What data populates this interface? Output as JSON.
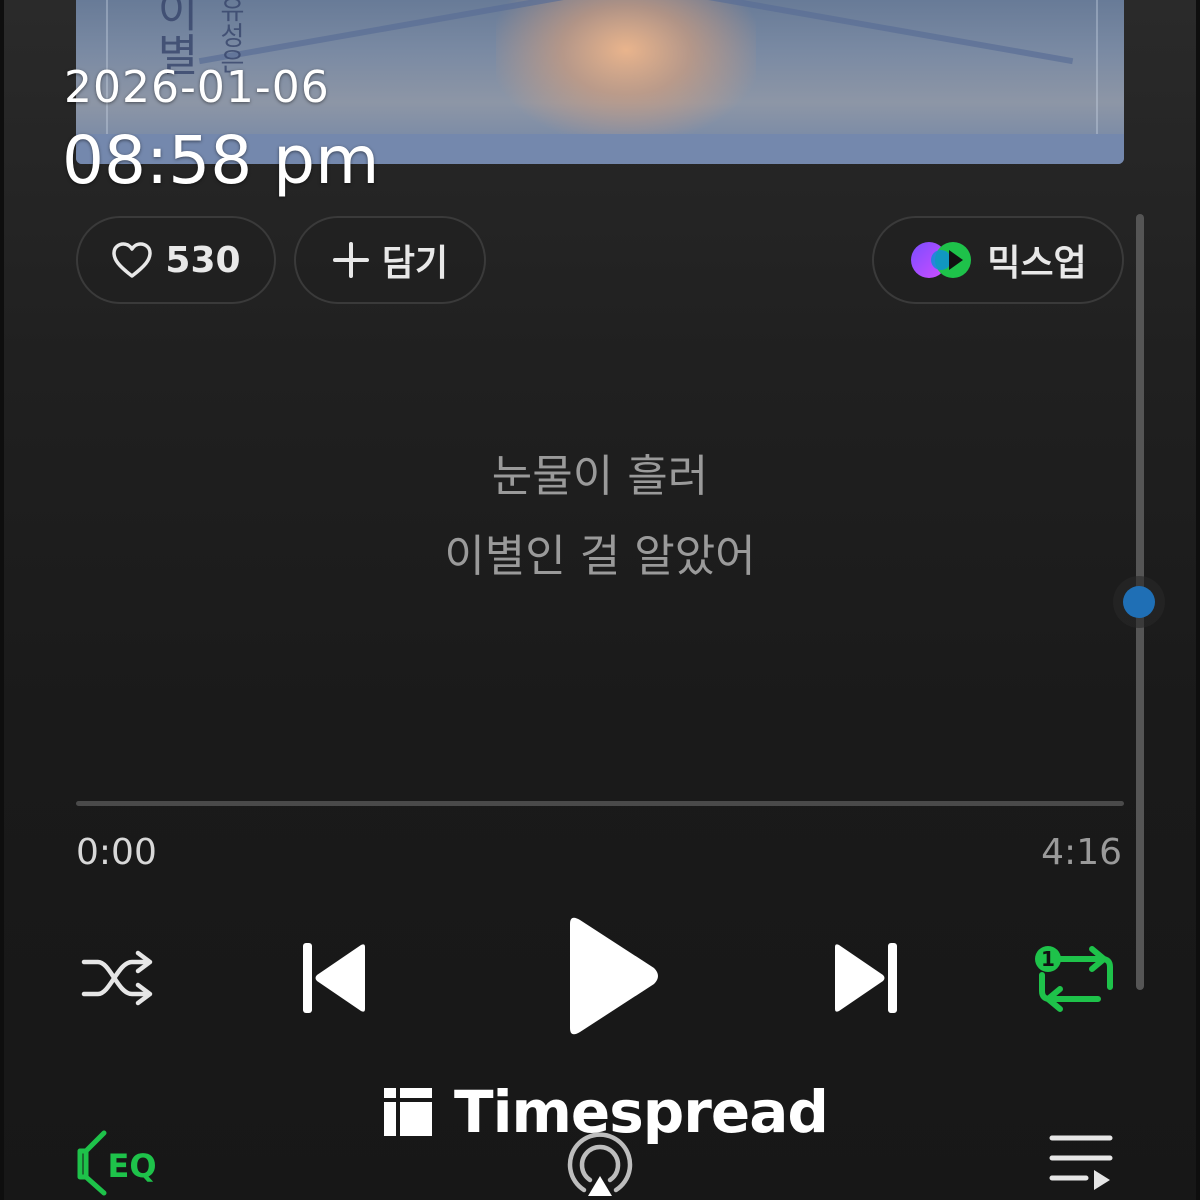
{
  "album_art": {
    "title_vertical": "이별",
    "artist_vertical": "유성은"
  },
  "timestamp": {
    "date": "2026-01-06",
    "time": "08:58 pm"
  },
  "actions": {
    "like_count": "530",
    "add_label": "담기",
    "mixup_label": "믹스업"
  },
  "lyrics": {
    "line1": "눈물이 흘러",
    "line2": "이별인 걸 알았어"
  },
  "playback": {
    "current_time": "0:00",
    "total_time": "4:16",
    "progress_fraction": 0.0,
    "repeat_mode_badge": "1"
  },
  "eq_label": "EQ",
  "watermark": {
    "text": "Timespread"
  },
  "colors": {
    "accent_green": "#1ec24a",
    "scroll_thumb": "#1f6fb5"
  },
  "icons": {
    "like": "heart-icon",
    "add": "plus-icon",
    "mixup": "mixup-logo-icon",
    "shuffle": "shuffle-icon",
    "prev": "skip-previous-icon",
    "play": "play-icon",
    "next": "skip-next-icon",
    "repeat": "repeat-one-icon",
    "eq": "eq-icon",
    "cast": "airplay-icon",
    "queue": "playlist-icon"
  }
}
